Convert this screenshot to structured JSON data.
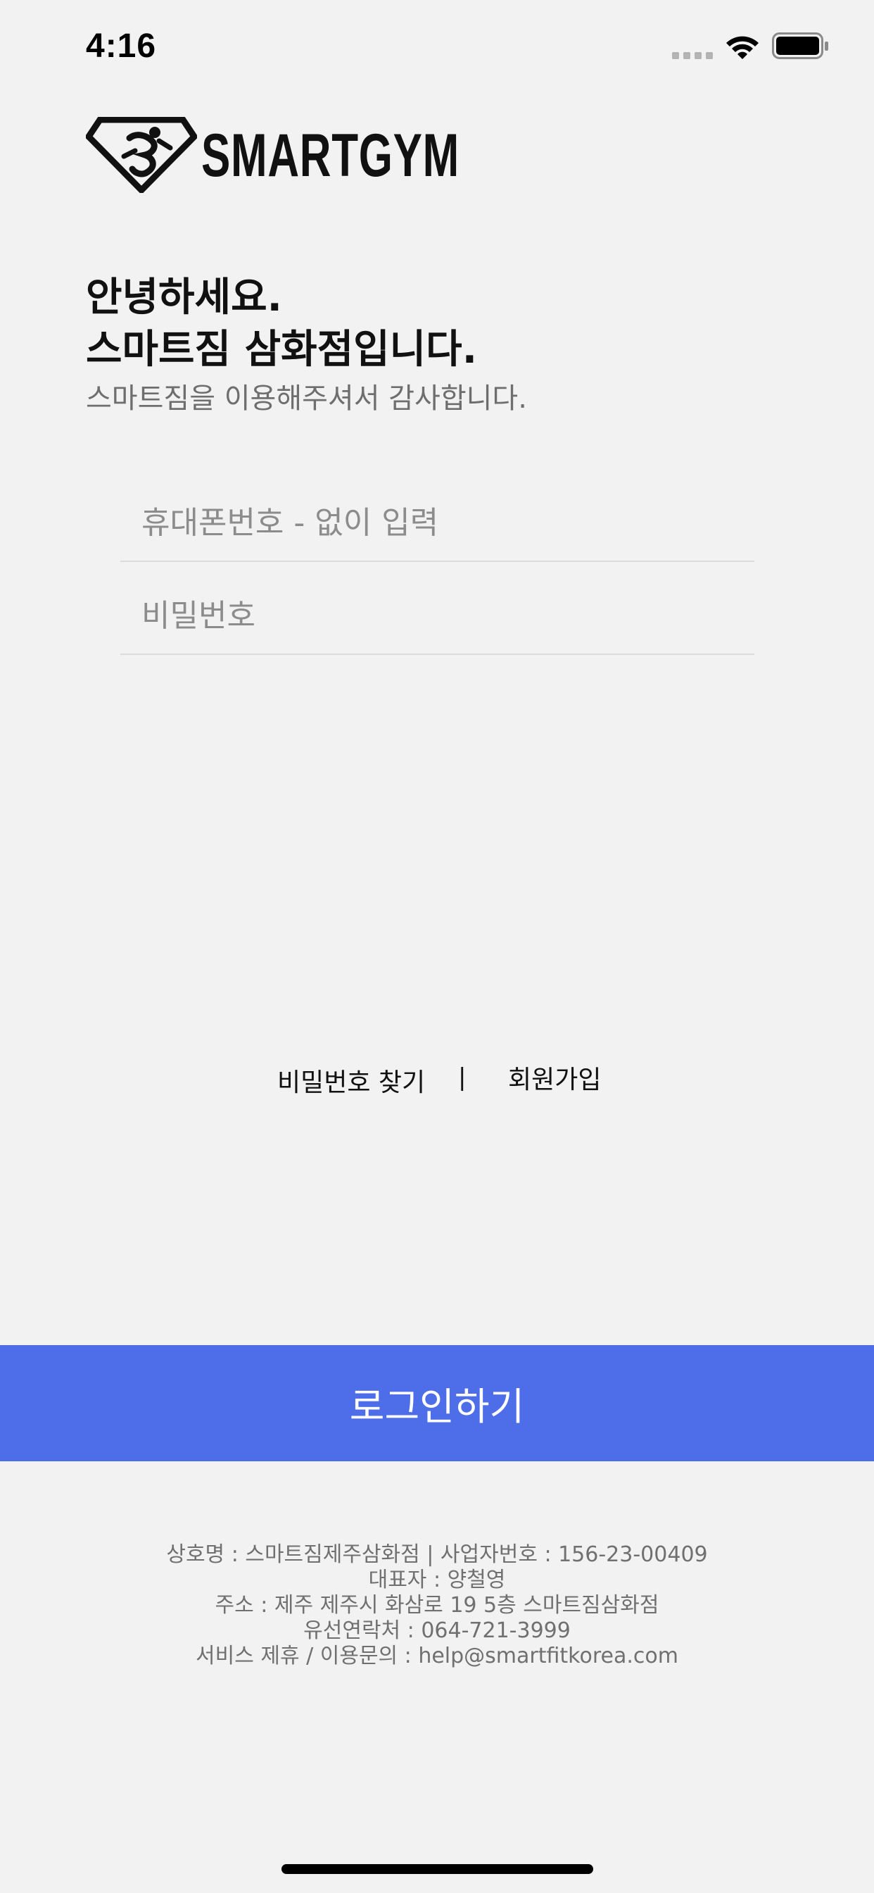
{
  "status_bar": {
    "time": "4:16"
  },
  "icons": {
    "signal": "cellular-signal-icon",
    "wifi": "wifi-icon",
    "battery": "battery-icon",
    "logo": "smartgym-logo-mark"
  },
  "brand": {
    "name": "SMARTGYM"
  },
  "greeting": {
    "line1": "안녕하세요.",
    "line2": "스마트짐 삼화점입니다.",
    "subtitle": "스마트짐을 이용해주셔서 감사합니다."
  },
  "form": {
    "phone_placeholder": "휴대폰번호 - 없이 입력",
    "phone_value": "",
    "password_placeholder": "비밀번호",
    "password_value": ""
  },
  "links": {
    "find_password": "비밀번호 찾기",
    "divider": "|",
    "signup": "회원가입"
  },
  "login_button": {
    "label": "로그인하기"
  },
  "footer": {
    "line1": "상호명 : 스마트짐제주삼화점 | 사업자번호 : 156-23-00409",
    "line2": "대표자 : 양철영",
    "line3": "주소 : 제주 제주시 화삼로 19 5층 스마트짐삼화점",
    "line4": "유선연락처 : 064-721-3999",
    "line5": "서비스 제휴 / 이용문의 : help@smartfitkorea.com"
  },
  "colors": {
    "background": "#f2f2f2",
    "accent": "#4e6ee9",
    "text_primary": "#111111",
    "text_secondary": "#707070"
  }
}
